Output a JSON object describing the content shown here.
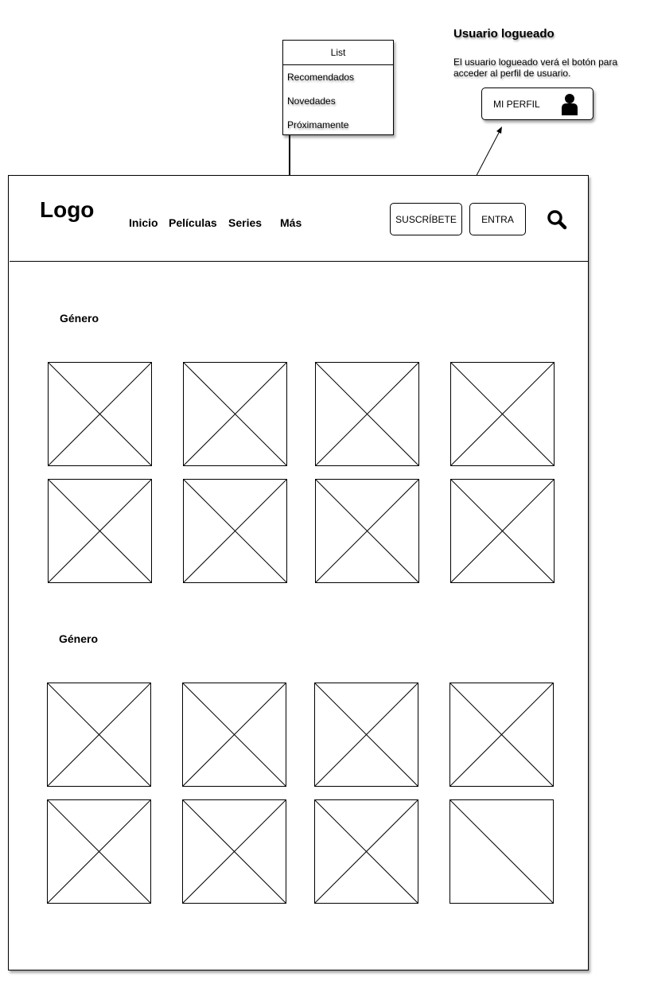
{
  "header": {
    "logo": "Logo",
    "nav": [
      "Inicio",
      "Películas",
      "Series",
      "Más"
    ],
    "subscribe_label": "SUSCRÍBETE",
    "login_label": "ENTRA"
  },
  "dropdown": {
    "title": "List",
    "items": [
      "Recomendados",
      "Novedades",
      "Próximamente"
    ]
  },
  "note": {
    "title": "Usuario logueado",
    "text": "El usuario logueado verá el botón para acceder al perfil de usuario.",
    "profile_label": "MI PERFIL"
  },
  "sections": [
    {
      "title": "Género",
      "placeholders": 8
    },
    {
      "title": "Género",
      "placeholders": 8
    }
  ],
  "icons": {
    "search": "search-icon",
    "user": "user-icon"
  }
}
